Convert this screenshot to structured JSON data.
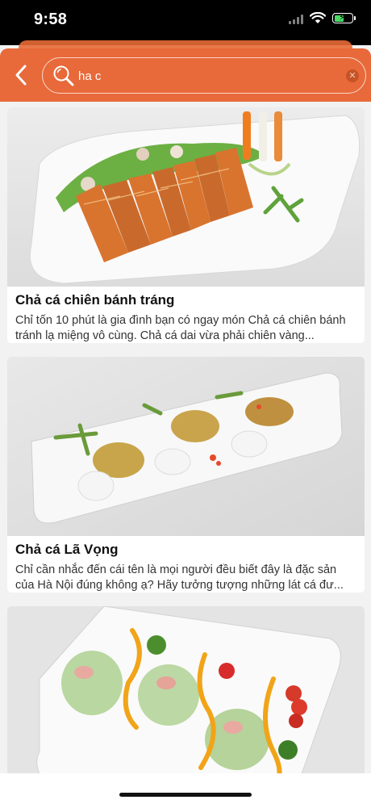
{
  "status_bar": {
    "time": "9:58"
  },
  "search": {
    "query": "ha c"
  },
  "colors": {
    "header": "#e8693a",
    "card_bg": "#ffffff",
    "page_bg": "#f2f2f2"
  },
  "recipes": [
    {
      "title": "Chả cá chiên bánh tráng",
      "description": "Chỉ tốn 10 phút là gia đình bạn có ngay món Chả cá chiên bánh tránh lạ miệng vô cùng. Chả cá dai vừa phải chiên vàng..."
    },
    {
      "title": "Chả cá Lã Vọng",
      "description": "Chỉ cần nhắc đến cái tên là mọi người đều biết đây là đặc sản của Hà Nội đúng không ạ? Hãy tưởng tượng những lát cá đư..."
    },
    {
      "title": "",
      "description": ""
    }
  ]
}
